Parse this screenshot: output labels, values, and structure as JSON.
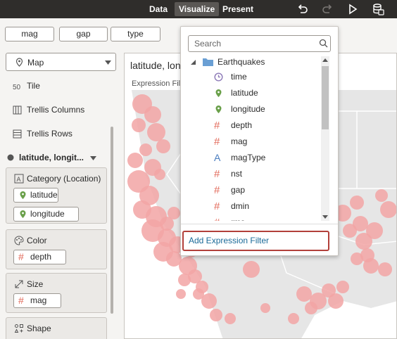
{
  "topbar": {
    "tabs": [
      {
        "label": "Data"
      },
      {
        "label": "Visualize"
      },
      {
        "label": "Present"
      }
    ],
    "icons": [
      "undo-icon",
      "redo-icon",
      "play-icon",
      "dataset-icon"
    ]
  },
  "filters": {
    "pills": [
      {
        "label": "mag"
      },
      {
        "label": "gap"
      },
      {
        "label": "type"
      }
    ]
  },
  "left_panel": {
    "viz_type": {
      "label": "Map",
      "icon": "map-pin-icon"
    },
    "menu": [
      {
        "label": "Tile",
        "icon": "tile-icon"
      },
      {
        "label": "Trellis Columns",
        "icon": "trellis-columns-icon"
      },
      {
        "label": "Trellis Rows",
        "icon": "trellis-rows-icon"
      }
    ],
    "layer": {
      "label": "latitude, longit..."
    },
    "sections": {
      "category": {
        "title": "Category (Location)",
        "chips": [
          "latitude",
          "longitude"
        ]
      },
      "color": {
        "title": "Color",
        "chips": [
          "depth"
        ]
      },
      "size": {
        "title": "Size",
        "chips": [
          "mag"
        ]
      },
      "shape": {
        "title": "Shape"
      }
    }
  },
  "canvas": {
    "title": "latitude, long",
    "subtitle": "Expression Filt"
  },
  "popup": {
    "search_placeholder": "Search",
    "folder": "Earthquakes",
    "fields": [
      {
        "label": "time",
        "kind": "time"
      },
      {
        "label": "latitude",
        "kind": "geo"
      },
      {
        "label": "longitude",
        "kind": "geo"
      },
      {
        "label": "depth",
        "kind": "number"
      },
      {
        "label": "mag",
        "kind": "number"
      },
      {
        "label": "magType",
        "kind": "text"
      },
      {
        "label": "nst",
        "kind": "number"
      },
      {
        "label": "gap",
        "kind": "number"
      },
      {
        "label": "dmin",
        "kind": "number"
      },
      {
        "label": "rms",
        "kind": "number"
      }
    ],
    "add_filter_label": "Add Expression Filter"
  },
  "colors": {
    "topbar": "#2f2d2b",
    "accent_link": "#1a6a98",
    "highlight_border": "#b2403a",
    "bubble": "#f2a5a5",
    "number_icon": "#e26a5a",
    "geo_icon": "#6aa04a",
    "time_icon": "#8c79b7",
    "text_icon": "#4a7dbf"
  }
}
